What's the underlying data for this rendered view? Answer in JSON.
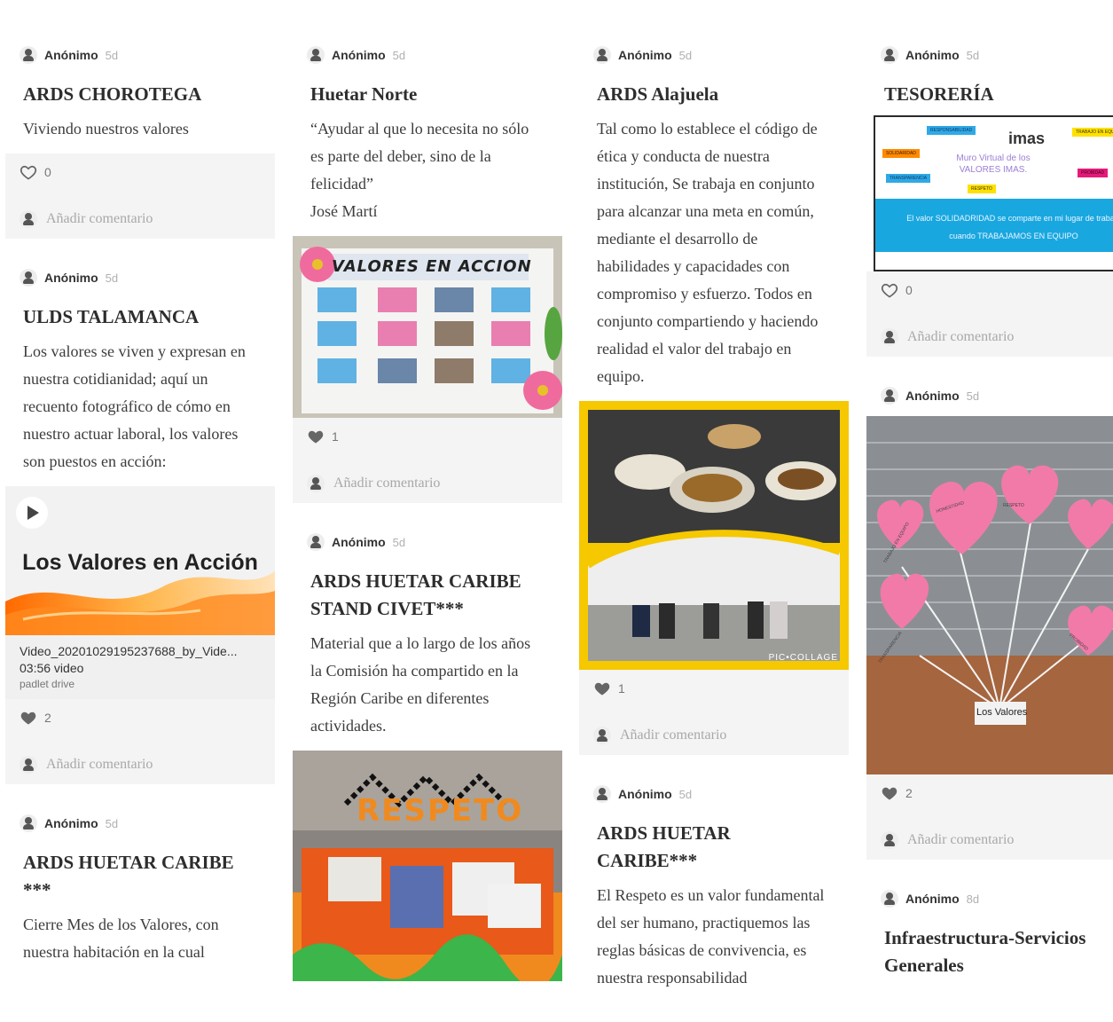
{
  "columns": [
    {
      "posts": [
        {
          "author": "Anónimo",
          "time": "5d",
          "title": "ARDS CHOROTEGA",
          "body": "Viviendo nuestros valores",
          "likes": "0",
          "liked": false,
          "comment_placeholder": "Añadir comentario"
        },
        {
          "author": "Anónimo",
          "time": "5d",
          "title": "ULDS TALAMANCA",
          "body": "Los valores se viven y expresan en nuestra cotidianidad; aquí un recuento fotográfico de cómo en nuestro actuar laboral, los valores son puestos en acción:",
          "video": {
            "thumb_title": "Los Valores en Acción",
            "filename": "Video_20201029195237688_by_Vide...",
            "meta": "03:56 video",
            "source": "padlet drive"
          },
          "likes": "2",
          "liked": true,
          "comment_placeholder": "Añadir comentario"
        },
        {
          "author": "Anónimo",
          "time": "5d",
          "title": "ARDS HUETAR CARIBE ***",
          "body": "Cierre  Mes de los Valores, con nuestra habitación en la cual"
        }
      ]
    },
    {
      "posts": [
        {
          "author": "Anónimo",
          "time": "5d",
          "title": "Huetar Norte",
          "body": "“Ayudar al que lo necesita no sólo es parte del deber, sino de la felicidad”\nJosé Martí",
          "image": {
            "banner": "VALORES EN ACCION"
          },
          "likes": "1",
          "liked": true,
          "comment_placeholder": "Añadir comentario"
        },
        {
          "author": "Anónimo",
          "time": "5d",
          "title": "ARDS HUETAR CARIBE STAND CIVET***",
          "body": "Material que a lo largo de los años la Comisión ha compartido en la Región Caribe en diferentes actividades.",
          "image": {
            "banner": "RESPETO"
          }
        }
      ]
    },
    {
      "posts": [
        {
          "author": "Anónimo",
          "time": "5d",
          "title": "ARDS Alajuela",
          "body": "Tal como lo establece el código de ética y conducta de nuestra institución, Se trabaja en conjunto para alcanzar una meta en común, mediante el desarrollo de habilidades y capacidades con compromiso y esfuerzo. Todos en conjunto compartiendo y haciendo realidad el valor del trabajo en equipo.",
          "image": {
            "watermark": "PIC•COLLAGE"
          },
          "likes": "1",
          "liked": true,
          "comment_placeholder": "Añadir comentario"
        },
        {
          "author": "Anónimo",
          "time": "5d",
          "title": "ARDS HUETAR CARIBE***",
          "body": "El Respeto es un valor fundamental del ser humano, practiquemos  las reglas básicas de convivencia, es nuestra responsabilidad"
        }
      ]
    },
    {
      "posts": [
        {
          "author": "Anónimo",
          "time": "5d",
          "title": "TESORERÍA",
          "image": {
            "logo": "imas",
            "heading": "Muro Virtual de los VALORES IMAS.",
            "tags": [
              "RESPONSABILIDAD",
              "SOLIDARIDAD",
              "TRANSPARENCIA",
              "RESPETO",
              "TRABAJO EN EQUIPO",
              "PROBIDAD"
            ],
            "sentence": "El valor SOLIDADRIDAD se comparte en mi lugar de trabajo cuando TRABAJAMOS EN EQUIPO"
          },
          "likes": "0",
          "liked": false,
          "comment_placeholder": "Añadir comentario"
        },
        {
          "author": "Anónimo",
          "time": "5d",
          "image": {
            "sign": "Los Valores",
            "balloons": [
              "HONESTIDAD",
              "RESPETO",
              "TRABAJO EN EQUIPO",
              "TRANSPARENCIA",
              "PROBIDAD"
            ]
          },
          "likes": "2",
          "liked": true,
          "comment_placeholder": "Añadir comentario"
        },
        {
          "author": "Anónimo",
          "time": "8d",
          "title": "Infraestructura-Servicios Generales"
        }
      ]
    }
  ]
}
